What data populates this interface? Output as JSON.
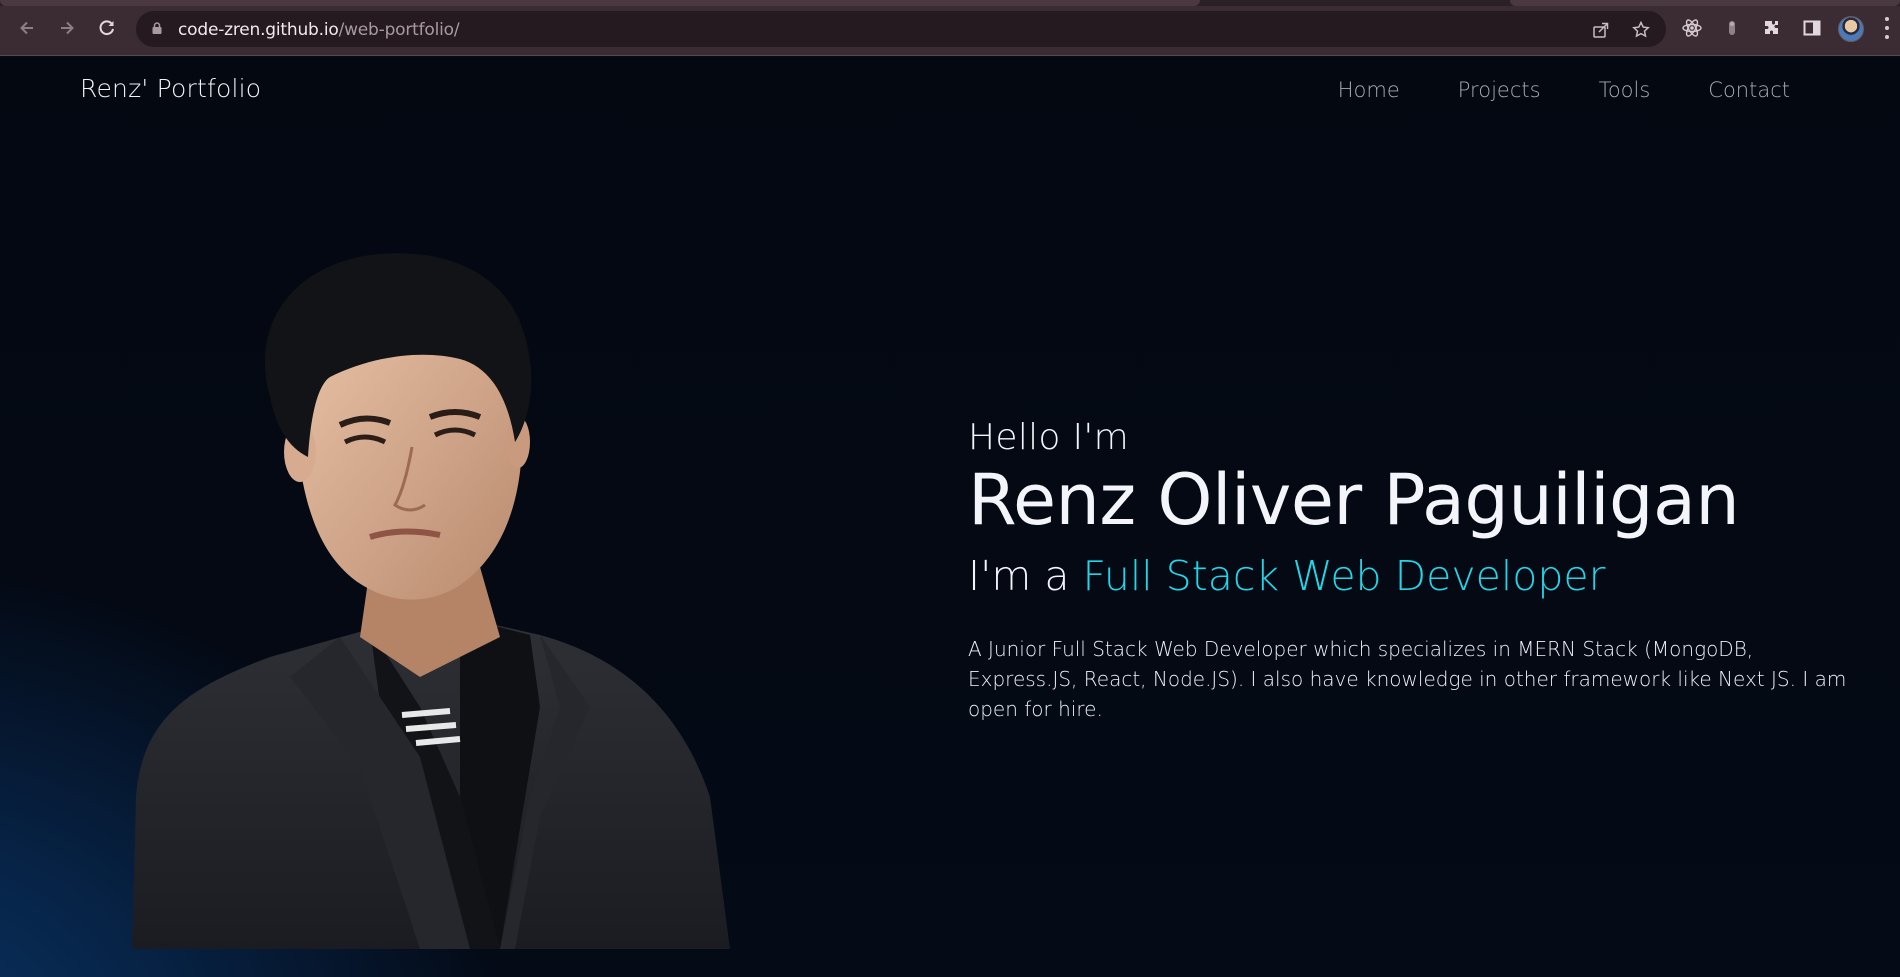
{
  "browser": {
    "url_host": "code-zren.github.io",
    "url_path": "/web-portfolio/",
    "icons": {
      "back": "back-arrow-icon",
      "forward": "forward-arrow-icon",
      "reload": "reload-icon",
      "lock": "lock-icon",
      "share": "share-icon",
      "bookmark": "star-icon",
      "react_devtools": "react-icon",
      "extension_2": "extension-icon",
      "extensions": "puzzle-icon",
      "side_panel": "side-panel-icon",
      "menu": "kebab-menu-icon"
    }
  },
  "site": {
    "brand": "Renz' Portfolio",
    "nav": [
      {
        "label": "Home"
      },
      {
        "label": "Projects"
      },
      {
        "label": "Tools"
      },
      {
        "label": "Contact"
      }
    ]
  },
  "hero": {
    "greeting": "Hello I'm",
    "name": "Renz Oliver Paguiligan",
    "role_prefix": "I'm a ",
    "role_highlight": "Full Stack Web Developer",
    "bio": "A Junior Full Stack Web Developer which specializes in MERN Stack (MongoDB, Express.JS, React, Node.JS). I also have knowledge in other framework like Next JS. I am open for hire."
  },
  "colors": {
    "accent": "#22d6e8",
    "background": "#040a16",
    "chrome": "#3b2c33"
  }
}
